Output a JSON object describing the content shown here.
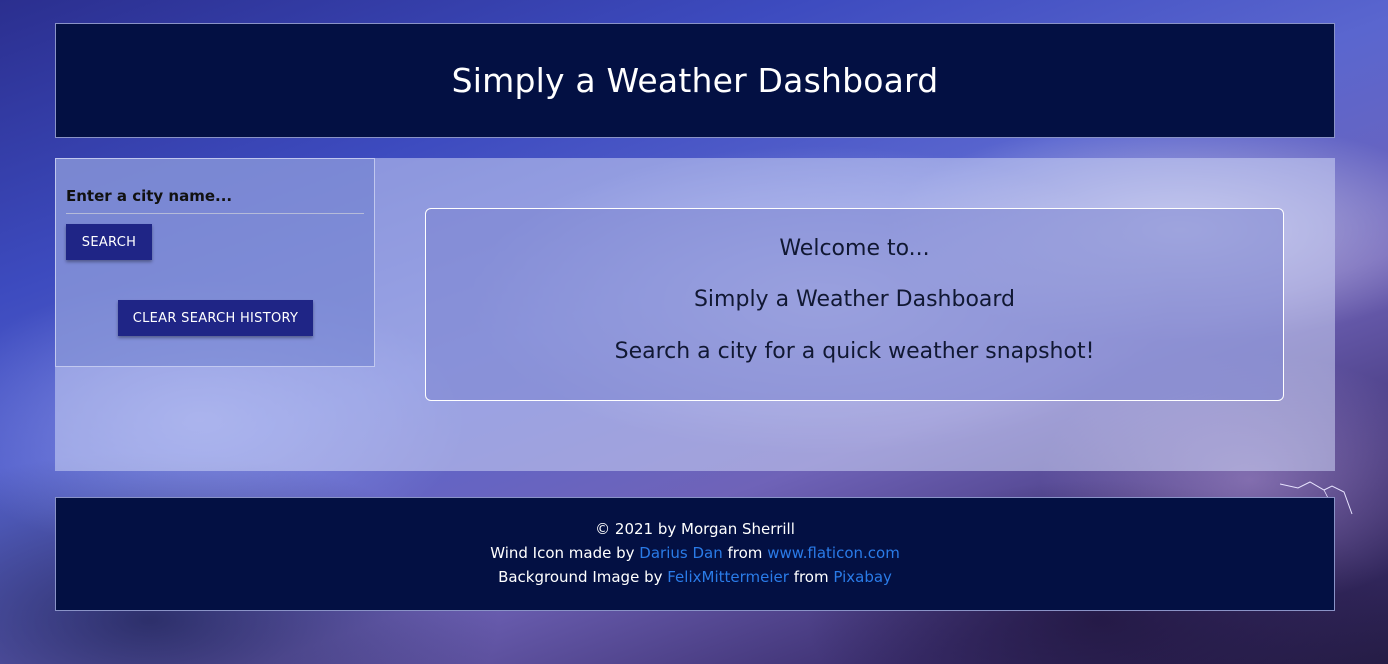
{
  "header": {
    "title": "Simply a Weather Dashboard"
  },
  "sidebar": {
    "search_placeholder": "Enter a city name...",
    "search_button": "SEARCH",
    "clear_button": "CLEAR SEARCH HISTORY"
  },
  "welcome": {
    "line1": "Welcome to...",
    "title": "Simply a Weather Dashboard",
    "subtitle": "Search a city for a quick weather snapshot!"
  },
  "footer": {
    "copyright": "© 2021 by Morgan Sherrill",
    "wind_prefix": "Wind Icon made by",
    "wind_author": "Darius Dan",
    "from1": "from",
    "wind_site": "www.flaticon.com",
    "bg_prefix": "Background Image by",
    "bg_author": "FelixMittermeier",
    "from2": "from",
    "bg_site": "Pixabay"
  },
  "colors": {
    "header_bg": "#031043",
    "button_bg": "#1f2586",
    "link": "#2a7be8"
  }
}
